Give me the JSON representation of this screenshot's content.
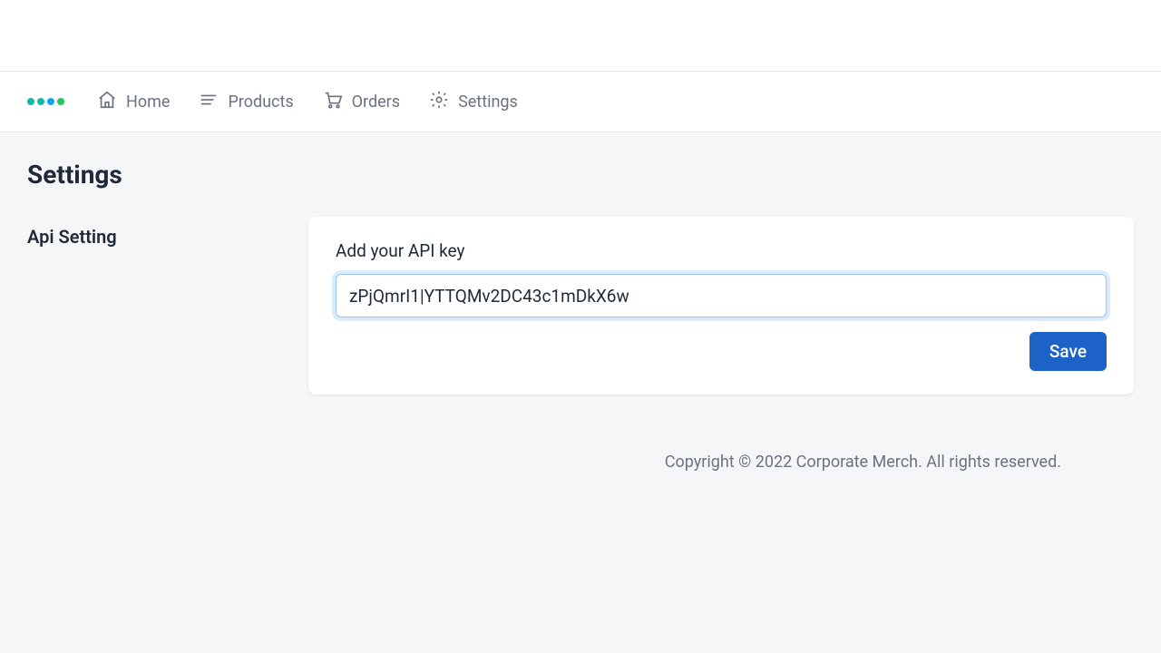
{
  "nav": {
    "items": [
      {
        "label": "Home"
      },
      {
        "label": "Products"
      },
      {
        "label": "Orders"
      },
      {
        "label": "Settings"
      }
    ]
  },
  "logo": {
    "dot_colors": [
      "#14b8a6",
      "#14b8a6",
      "#0ea5e9",
      "#22c55e"
    ]
  },
  "page": {
    "title": "Settings",
    "section_label": "Api Setting"
  },
  "form": {
    "api_key_label": "Add your API key",
    "api_key_value": "zPjQmrI1|YTTQMv2DC43c1mDkX6w",
    "save_label": "Save"
  },
  "footer": {
    "copyright": "Copyright © 2022 Corporate Merch. All rights reserved."
  }
}
